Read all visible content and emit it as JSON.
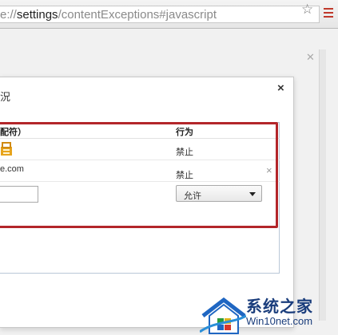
{
  "browser": {
    "url_prefix": "e://",
    "url_strong": "settings",
    "url_rest": "/contentExceptions#javascript",
    "bookmark_icon": "star-icon",
    "menu_icon": "hamburger-menu-icon"
  },
  "settings_page": {
    "close_icon": "close-icon"
  },
  "dialog": {
    "title": "況",
    "close_label": "×",
    "columns": {
      "pattern": "配符）",
      "behavior": "行为"
    },
    "rows": [
      {
        "pattern_icon": "site-icon",
        "behavior": "禁止"
      },
      {
        "pattern": "e.com",
        "behavior": "禁止",
        "delete_label": "×"
      }
    ],
    "new_row": {
      "pattern_value": "",
      "behavior_selected": "允许",
      "behavior_options": [
        "允许"
      ]
    }
  },
  "annotation": {
    "highlight_color": "#b3262a"
  },
  "watermark": {
    "line1": "系统之家",
    "line2": "Win10net.com"
  },
  "colors": {
    "accent_red": "#b3262a",
    "watermark_blue": "#1a3d7c"
  }
}
